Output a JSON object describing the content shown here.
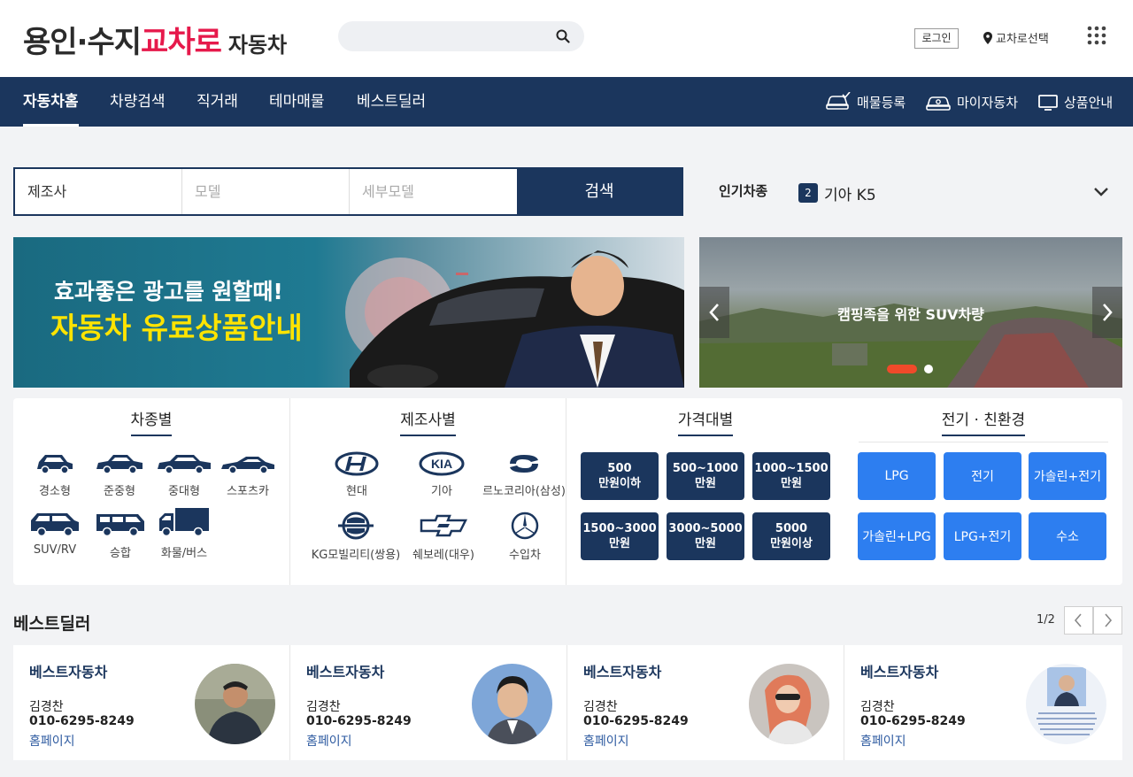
{
  "header": {
    "logo": {
      "part1": "용인·수지",
      "part2": "교차로",
      "part3": "자동차"
    },
    "search": {
      "placeholder": ""
    },
    "login": "로그인",
    "region": "교차로선택"
  },
  "nav": {
    "items": [
      {
        "label": "자동차홈",
        "active": true
      },
      {
        "label": "차량검색"
      },
      {
        "label": "직거래"
      },
      {
        "label": "테마매물"
      },
      {
        "label": "베스트딜러"
      }
    ],
    "right": [
      {
        "label": "매물등록",
        "icon": "car-check-icon"
      },
      {
        "label": "마이자동차",
        "icon": "my-car-icon"
      },
      {
        "label": "상품안내",
        "icon": "monitor-icon"
      }
    ]
  },
  "car_search": {
    "maker": "제조사",
    "model": "모델",
    "submodel": "세부모델",
    "button": "검색",
    "popular_label": "인기차종",
    "popular_rank": "2",
    "popular_car": "기아 K5"
  },
  "banners": {
    "left_line1": "효과좋은 광고를 원할때!",
    "left_line2": "자동차 유료상품안내",
    "right_caption": "캠핑족을 위한 SUV차량"
  },
  "categories": {
    "body": {
      "title": "차종별",
      "items": [
        "경소형",
        "준중형",
        "중대형",
        "스포츠카",
        "SUV/RV",
        "승합",
        "화물/버스"
      ]
    },
    "maker": {
      "title": "제조사별",
      "items": [
        "현대",
        "기아",
        "르노코리아(삼성)",
        "KG모빌리티(쌍용)",
        "쉐보레(대우)",
        "수입차"
      ],
      "kia_logo": "KIA"
    },
    "price": {
      "title": "가격대별",
      "items": [
        {
          "l1": "500",
          "l2": "만원이하"
        },
        {
          "l1": "500~1000",
          "l2": "만원"
        },
        {
          "l1": "1000~1500",
          "l2": "만원"
        },
        {
          "l1": "1500~3000",
          "l2": "만원"
        },
        {
          "l1": "3000~5000",
          "l2": "만원"
        },
        {
          "l1": "5000",
          "l2": "만원이상"
        }
      ]
    },
    "eco": {
      "title": "전기 · 친환경",
      "items": [
        "LPG",
        "전기",
        "가솔린+전기",
        "가솔린+LPG",
        "LPG+전기",
        "수소"
      ]
    }
  },
  "best_dealer": {
    "title": "베스트딜러",
    "page": "1/2",
    "dealers": [
      {
        "name": "베스트자동차",
        "person": "김경찬",
        "phone": "010-6295-8249",
        "link": "홈페이지"
      },
      {
        "name": "베스트자동차",
        "person": "김경찬",
        "phone": "010-6295-8249",
        "link": "홈페이지"
      },
      {
        "name": "베스트자동차",
        "person": "김경찬",
        "phone": "010-6295-8249",
        "link": "홈페이지"
      },
      {
        "name": "베스트자동차",
        "person": "김경찬",
        "phone": "010-6295-8249",
        "link": "홈페이지"
      }
    ]
  },
  "colors": {
    "navy": "#1b365d",
    "brand_red": "#e6194b",
    "eco_blue": "#2d7ef0",
    "banner_yellow": "#ffe400"
  }
}
